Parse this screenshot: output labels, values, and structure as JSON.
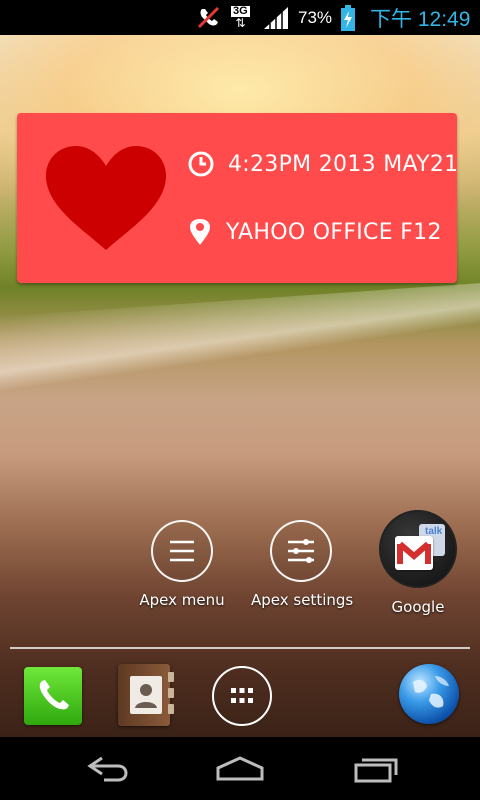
{
  "status_bar": {
    "network_type": "3G",
    "battery_percent": "73%",
    "time": "下午 12:49",
    "icons": [
      "missed-call-icon",
      "3g-data-icon",
      "signal-strength-icon",
      "battery-charging-icon"
    ],
    "time_color": "#33b5e5"
  },
  "widget": {
    "background_color": "#ff4b4b",
    "heart_color": "#cc0000",
    "datetime": "4:23PM  2013 MAY21",
    "location": "YAHOO OFFICE F12",
    "icons": [
      "heart-icon",
      "clock-icon",
      "location-pin-icon"
    ]
  },
  "home_apps": [
    {
      "label": "Apex menu",
      "icon": "menu-lines-icon"
    },
    {
      "label": "Apex settings",
      "icon": "sliders-icon"
    },
    {
      "label": "Google",
      "icon": "gmail-talk-folder-icon"
    }
  ],
  "dock": {
    "items": [
      "phone-icon",
      "contacts-icon",
      "app-drawer-icon",
      "browser-globe-icon"
    ],
    "phone_color": "#44c21a",
    "contacts_color": "#8a5a3a"
  },
  "nav_bar": {
    "buttons": [
      "back-icon",
      "home-icon",
      "recent-apps-icon"
    ]
  }
}
